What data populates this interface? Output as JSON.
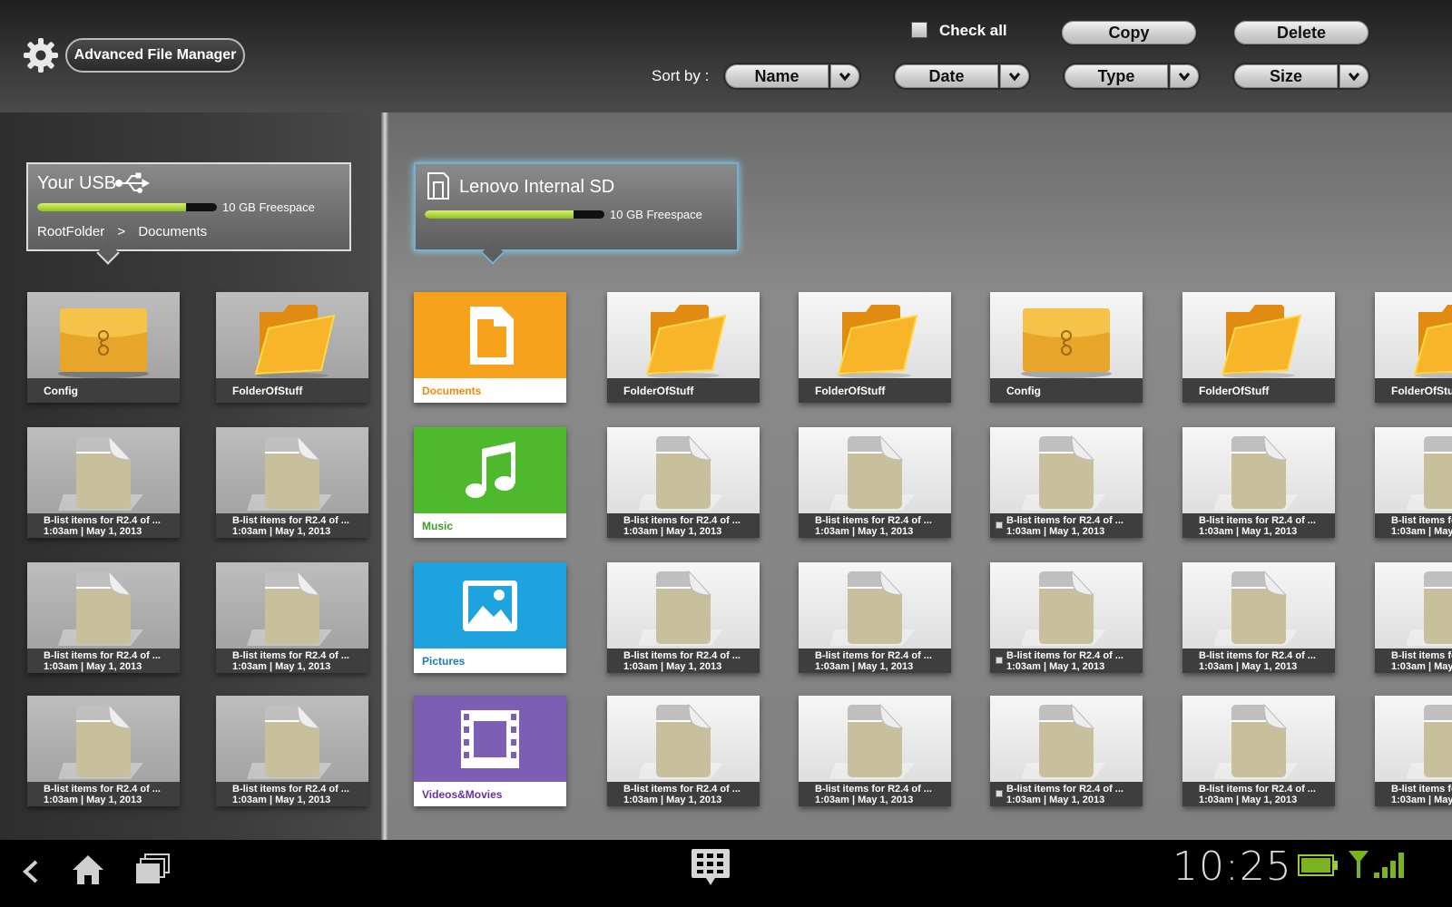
{
  "app": {
    "title": "Advanced File Manager"
  },
  "toolbar": {
    "check_all_label": "Check all",
    "copy_label": "Copy",
    "delete_label": "Delete",
    "sort_by_label": "Sort by :",
    "sort_options": [
      "Name",
      "Date",
      "Type",
      "Size"
    ]
  },
  "usb": {
    "name": "Your USB",
    "freespace": "10 GB Freespace",
    "used_fraction": 0.83,
    "breadcrumb": [
      "RootFolder",
      ">",
      "Documents"
    ]
  },
  "sd": {
    "name": "Lenovo Internal SD",
    "freespace": "10 GB Freespace",
    "used_fraction": 0.83
  },
  "file_caption": {
    "line1": "B-list items for R2.4 of ...",
    "line2": "1:03am | May 1, 2013"
  },
  "left_grid": [
    [
      {
        "type": "config",
        "label": "Config"
      },
      {
        "type": "folder",
        "label": "FolderOfStuff"
      }
    ],
    [
      {
        "type": "file"
      },
      {
        "type": "file"
      }
    ],
    [
      {
        "type": "file"
      },
      {
        "type": "file"
      }
    ],
    [
      {
        "type": "file"
      },
      {
        "type": "file"
      }
    ]
  ],
  "categories": [
    {
      "label": "Documents",
      "color": "#f7a21c",
      "label_color": "#f08a0c",
      "icon": "document-icon"
    },
    {
      "label": "Music",
      "color": "#4fb92e",
      "label_color": "#3f9a22",
      "icon": "music-note-icon"
    },
    {
      "label": "Pictures",
      "color": "#1ea3de",
      "label_color": "#1a7bb8",
      "icon": "picture-icon"
    },
    {
      "label": "Videos&Movies",
      "color": "#7c5fb5",
      "label_color": "#6a2fa0",
      "icon": "film-icon"
    }
  ],
  "right_grid": [
    [
      {
        "type": "folder",
        "label": "FolderOfStuff"
      },
      {
        "type": "folder",
        "label": "FolderOfStuff"
      },
      {
        "type": "config",
        "label": "Config"
      },
      {
        "type": "folder",
        "label": "FolderOfStuff"
      },
      {
        "type": "folder",
        "label": "FolderOfStuff"
      }
    ],
    [
      {
        "type": "file"
      },
      {
        "type": "file"
      },
      {
        "type": "file",
        "checkbox": true
      },
      {
        "type": "file"
      },
      {
        "type": "file"
      }
    ],
    [
      {
        "type": "file"
      },
      {
        "type": "file"
      },
      {
        "type": "file",
        "checkbox": true
      },
      {
        "type": "file"
      },
      {
        "type": "file"
      }
    ],
    [
      {
        "type": "file"
      },
      {
        "type": "file"
      },
      {
        "type": "file",
        "checkbox": true
      },
      {
        "type": "file"
      },
      {
        "type": "file"
      }
    ]
  ],
  "status": {
    "time": "10:25"
  },
  "colors": {
    "folder": "#f7a81c",
    "accent_bar": "#9ccf2a",
    "sd_glow": "#6fb3d2"
  }
}
